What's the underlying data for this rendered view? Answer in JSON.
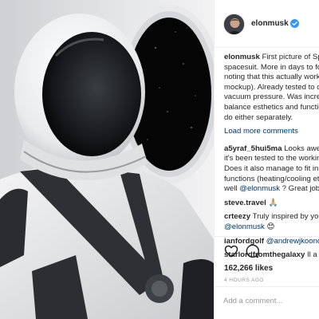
{
  "post": {
    "username": "elonmusk",
    "verified_icon": "verified-badge-icon",
    "likes": "162,266 likes",
    "timestamp": "4 HOURS AGO",
    "add_comment_placeholder": "Add a comment..."
  },
  "caption": {
    "user": "elonmusk",
    "lines": [
      "First picture of SpaceX",
      "spacesuit. More in days to follow.",
      "noting that this actually works (not a",
      "mockup). Already tested to double",
      "vacuum pressure. Was incredibly hard",
      "balance esthetics and function. Easy",
      "do either separately."
    ]
  },
  "load_more": "Load more comments",
  "comments": [
    {
      "user": "a5yraf_5hui5ma",
      "lines": [
        "Looks awesome! Has",
        "it's been tested to the working envir",
        "Does it also manage to fit in other",
        "functions (heating/cooling etc...) as",
        "well"
      ],
      "mention": "@elonmusk",
      "tail": " ? Great job"
    },
    {
      "user": "steve.travel",
      "text": "🙏🏼"
    },
    {
      "user": "crteezy",
      "text": "Truly inspired by your work",
      "mention": "@elonmusk",
      "tail": " 😍"
    },
    {
      "user": "ianfordgolf",
      "mention": "@andrewjkooncey"
    },
    {
      "user": "starlordfromthegalaxy",
      "text": "Il a vraiment"
    }
  ],
  "icons": {
    "like": "heart-icon",
    "comment": "comment-bubble-icon"
  },
  "colors": {
    "text": "#262626",
    "link": "#003569",
    "muted": "#999999",
    "verified": "#3897f0",
    "border": "#efefef"
  }
}
